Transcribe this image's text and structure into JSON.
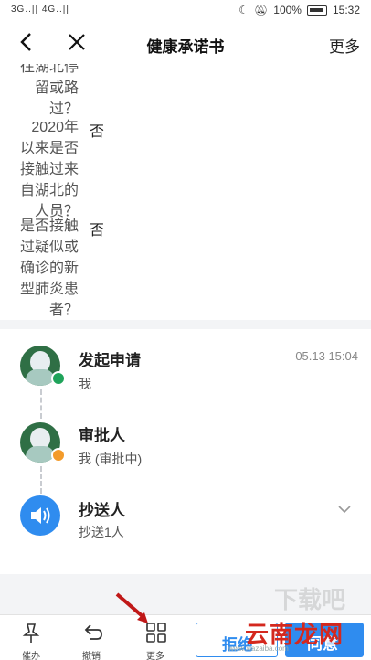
{
  "status_bar": {
    "signal_text": "3G..|| 4G..||",
    "battery_percent": "100%",
    "time": "15:32"
  },
  "navbar": {
    "title": "健康承诺书",
    "more_label": "更多"
  },
  "form": {
    "partial_question_lines": [
      "往湖北停",
      "留或路",
      "过？"
    ],
    "questions": [
      {
        "lines": [
          "2020年",
          "以来是否",
          "接触过来",
          "自湖北的",
          "人员？"
        ],
        "answer": "否"
      },
      {
        "lines": [
          "是否接触",
          "过疑似或",
          "确诊的新",
          "型肺炎患",
          "者？"
        ],
        "answer": "否"
      }
    ]
  },
  "flow": {
    "steps": [
      {
        "title": "发起申请",
        "sub": "我",
        "time": "05.13 15:04"
      },
      {
        "title": "审批人",
        "sub": "我 (审批中)"
      },
      {
        "title": "抄送人",
        "sub": "抄送1人"
      }
    ]
  },
  "bottom_bar": {
    "tabs": [
      {
        "label": "催办",
        "icon": "pin-icon"
      },
      {
        "label": "撤销",
        "icon": "undo-icon"
      },
      {
        "label": "更多",
        "icon": "grid-icon"
      }
    ],
    "reject_label": "拒绝",
    "agree_label": "同意"
  },
  "watermark": {
    "main": "云南龙网",
    "faint": "下载吧",
    "url": "www.xiazaiba.com"
  },
  "colors": {
    "accent": "#2f8cef",
    "watermark_red": "#d4281e",
    "badge_green": "#1fa35a",
    "badge_orange": "#f39b2a"
  }
}
